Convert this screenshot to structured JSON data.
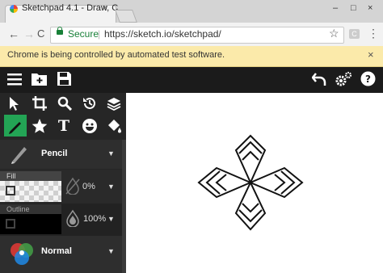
{
  "browser": {
    "tab_title": "Sketchpad 4.1 - Draw, C",
    "tab_close": "×",
    "window_buttons": [
      "–",
      "□",
      "×"
    ],
    "back": "←",
    "forward": "→",
    "reload": "C",
    "secure_label": "Secure",
    "url_separator": "|",
    "url": "https://sketch.io/sketchpad/",
    "star": "☆",
    "ext_label": "C",
    "menu": "⋮"
  },
  "infobar": {
    "message": "Chrome is being controlled by automated test software.",
    "close": "×"
  },
  "app": {
    "accent_color": "#23a455",
    "tools_row1": [
      "select-arrow",
      "crop",
      "zoom",
      "history",
      "layers"
    ],
    "tools_row2": [
      "pencil",
      "star-shape",
      "text",
      "emoji",
      "fill-bucket"
    ],
    "text_tool_glyph": "T",
    "brush": {
      "label": "Pencil"
    },
    "fill": {
      "label": "Fill",
      "opacity": "0%"
    },
    "outline": {
      "label": "Outline",
      "opacity": "100%"
    },
    "blend": {
      "label": "Normal"
    }
  }
}
